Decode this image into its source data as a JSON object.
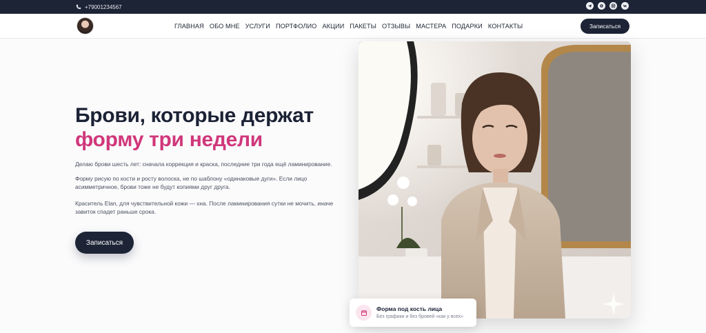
{
  "topbar": {
    "phone": "+79001234567",
    "socials": [
      {
        "icon": "telegram-icon"
      },
      {
        "icon": "max-messenger-icon"
      },
      {
        "icon": "instagram-icon"
      },
      {
        "icon": "vk-icon"
      }
    ]
  },
  "nav": {
    "items": [
      "ГЛАВНАЯ",
      "ОБО МНЕ",
      "УСЛУГИ",
      "ПОРТФОЛИО",
      "АКЦИИ",
      "ПАКЕТЫ",
      "ОТЗЫВЫ",
      "МАСТЕРА",
      "ПОДАРКИ",
      "КОНТАКТЫ"
    ],
    "cta": "Записаться"
  },
  "hero": {
    "title_line1": "Брови, которые держат",
    "title_line2": "форму три недели",
    "p1": "Делаю брови шесть лет: сначала коррекция и краска, последние три года ещё ламинирование.",
    "p2": "Форму рисую по кости и росту волоска, не по шаблону «одинаковые дуги». Если лицо асимметричное, брови тоже не будут копиями друг друга.",
    "p3": "Краситель Elan, для чувствительной кожи — хна. После ламинирования сутки не мочить, иначе завиток спадет раньше срока.",
    "cta": "Записаться"
  },
  "card": {
    "title": "Форма под кость лица",
    "subtitle": "Без графики и без бровей «как у всех»"
  },
  "colors": {
    "navy": "#1d2436",
    "accent": "#d0377a"
  }
}
